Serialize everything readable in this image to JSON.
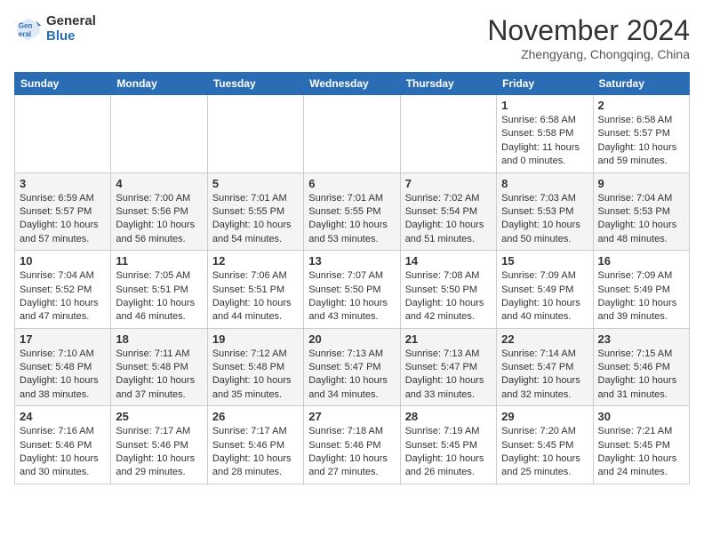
{
  "header": {
    "logo_general": "General",
    "logo_blue": "Blue",
    "month_title": "November 2024",
    "location": "Zhengyang, Chongqing, China"
  },
  "weekdays": [
    "Sunday",
    "Monday",
    "Tuesday",
    "Wednesday",
    "Thursday",
    "Friday",
    "Saturday"
  ],
  "weeks": [
    [
      {
        "day": "",
        "info": ""
      },
      {
        "day": "",
        "info": ""
      },
      {
        "day": "",
        "info": ""
      },
      {
        "day": "",
        "info": ""
      },
      {
        "day": "",
        "info": ""
      },
      {
        "day": "1",
        "info": "Sunrise: 6:58 AM\nSunset: 5:58 PM\nDaylight: 11 hours and 0 minutes."
      },
      {
        "day": "2",
        "info": "Sunrise: 6:58 AM\nSunset: 5:57 PM\nDaylight: 10 hours and 59 minutes."
      }
    ],
    [
      {
        "day": "3",
        "info": "Sunrise: 6:59 AM\nSunset: 5:57 PM\nDaylight: 10 hours and 57 minutes."
      },
      {
        "day": "4",
        "info": "Sunrise: 7:00 AM\nSunset: 5:56 PM\nDaylight: 10 hours and 56 minutes."
      },
      {
        "day": "5",
        "info": "Sunrise: 7:01 AM\nSunset: 5:55 PM\nDaylight: 10 hours and 54 minutes."
      },
      {
        "day": "6",
        "info": "Sunrise: 7:01 AM\nSunset: 5:55 PM\nDaylight: 10 hours and 53 minutes."
      },
      {
        "day": "7",
        "info": "Sunrise: 7:02 AM\nSunset: 5:54 PM\nDaylight: 10 hours and 51 minutes."
      },
      {
        "day": "8",
        "info": "Sunrise: 7:03 AM\nSunset: 5:53 PM\nDaylight: 10 hours and 50 minutes."
      },
      {
        "day": "9",
        "info": "Sunrise: 7:04 AM\nSunset: 5:53 PM\nDaylight: 10 hours and 48 minutes."
      }
    ],
    [
      {
        "day": "10",
        "info": "Sunrise: 7:04 AM\nSunset: 5:52 PM\nDaylight: 10 hours and 47 minutes."
      },
      {
        "day": "11",
        "info": "Sunrise: 7:05 AM\nSunset: 5:51 PM\nDaylight: 10 hours and 46 minutes."
      },
      {
        "day": "12",
        "info": "Sunrise: 7:06 AM\nSunset: 5:51 PM\nDaylight: 10 hours and 44 minutes."
      },
      {
        "day": "13",
        "info": "Sunrise: 7:07 AM\nSunset: 5:50 PM\nDaylight: 10 hours and 43 minutes."
      },
      {
        "day": "14",
        "info": "Sunrise: 7:08 AM\nSunset: 5:50 PM\nDaylight: 10 hours and 42 minutes."
      },
      {
        "day": "15",
        "info": "Sunrise: 7:09 AM\nSunset: 5:49 PM\nDaylight: 10 hours and 40 minutes."
      },
      {
        "day": "16",
        "info": "Sunrise: 7:09 AM\nSunset: 5:49 PM\nDaylight: 10 hours and 39 minutes."
      }
    ],
    [
      {
        "day": "17",
        "info": "Sunrise: 7:10 AM\nSunset: 5:48 PM\nDaylight: 10 hours and 38 minutes."
      },
      {
        "day": "18",
        "info": "Sunrise: 7:11 AM\nSunset: 5:48 PM\nDaylight: 10 hours and 37 minutes."
      },
      {
        "day": "19",
        "info": "Sunrise: 7:12 AM\nSunset: 5:48 PM\nDaylight: 10 hours and 35 minutes."
      },
      {
        "day": "20",
        "info": "Sunrise: 7:13 AM\nSunset: 5:47 PM\nDaylight: 10 hours and 34 minutes."
      },
      {
        "day": "21",
        "info": "Sunrise: 7:13 AM\nSunset: 5:47 PM\nDaylight: 10 hours and 33 minutes."
      },
      {
        "day": "22",
        "info": "Sunrise: 7:14 AM\nSunset: 5:47 PM\nDaylight: 10 hours and 32 minutes."
      },
      {
        "day": "23",
        "info": "Sunrise: 7:15 AM\nSunset: 5:46 PM\nDaylight: 10 hours and 31 minutes."
      }
    ],
    [
      {
        "day": "24",
        "info": "Sunrise: 7:16 AM\nSunset: 5:46 PM\nDaylight: 10 hours and 30 minutes."
      },
      {
        "day": "25",
        "info": "Sunrise: 7:17 AM\nSunset: 5:46 PM\nDaylight: 10 hours and 29 minutes."
      },
      {
        "day": "26",
        "info": "Sunrise: 7:17 AM\nSunset: 5:46 PM\nDaylight: 10 hours and 28 minutes."
      },
      {
        "day": "27",
        "info": "Sunrise: 7:18 AM\nSunset: 5:46 PM\nDaylight: 10 hours and 27 minutes."
      },
      {
        "day": "28",
        "info": "Sunrise: 7:19 AM\nSunset: 5:45 PM\nDaylight: 10 hours and 26 minutes."
      },
      {
        "day": "29",
        "info": "Sunrise: 7:20 AM\nSunset: 5:45 PM\nDaylight: 10 hours and 25 minutes."
      },
      {
        "day": "30",
        "info": "Sunrise: 7:21 AM\nSunset: 5:45 PM\nDaylight: 10 hours and 24 minutes."
      }
    ]
  ]
}
